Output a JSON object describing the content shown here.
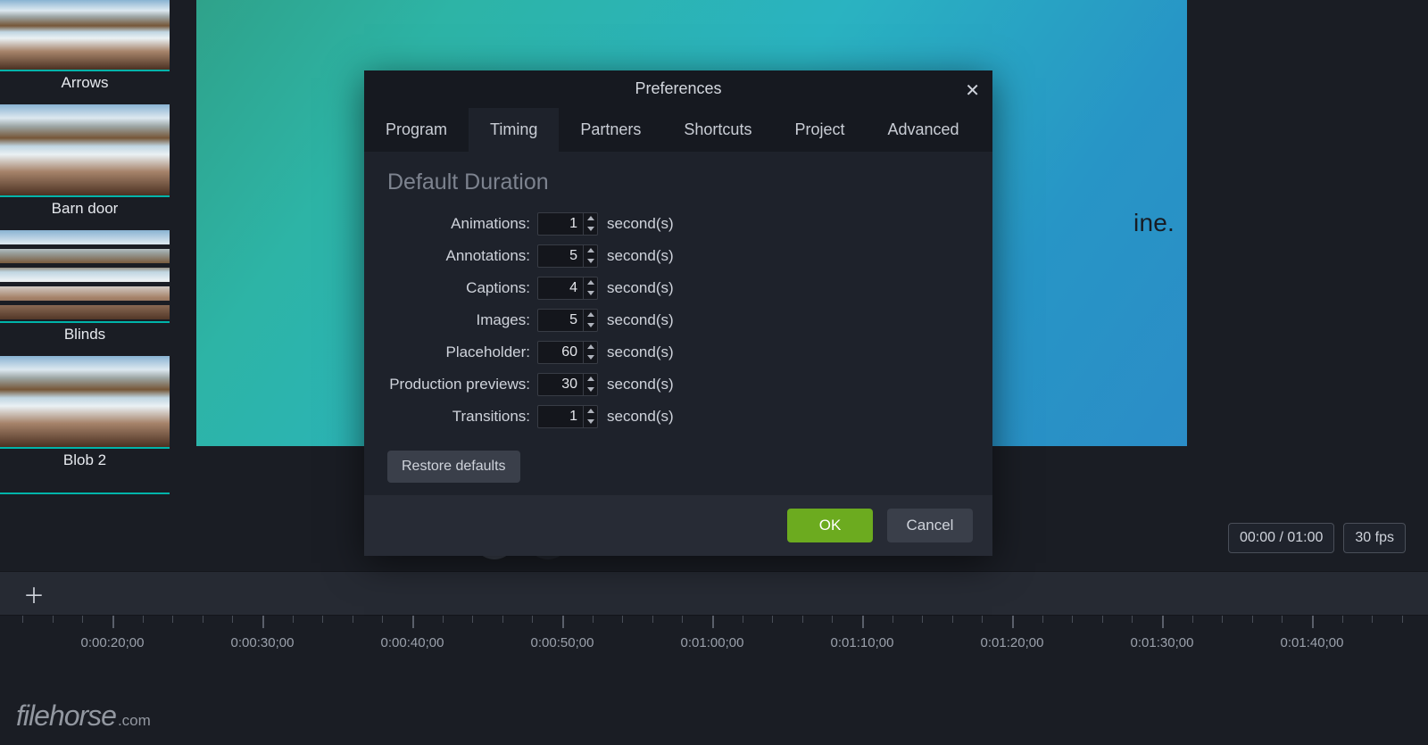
{
  "sidebar": {
    "items": [
      {
        "label": "Arrows"
      },
      {
        "label": "Barn door"
      },
      {
        "label": "Blinds"
      },
      {
        "label": "Blob 2"
      }
    ]
  },
  "canvas": {
    "heading_fragment": "ine."
  },
  "player": {
    "timecode": "00:00 / 01:00",
    "fps": "30 fps"
  },
  "timeline": {
    "ticks": [
      "0:00:20;00",
      "0:00:30;00",
      "0:00:40;00",
      "0:00:50;00",
      "0:01:00;00",
      "0:01:10;00",
      "0:01:20;00",
      "0:01:30;00",
      "0:01:40;00"
    ]
  },
  "dialog": {
    "title": "Preferences",
    "tabs": [
      "Program",
      "Timing",
      "Partners",
      "Shortcuts",
      "Project",
      "Advanced"
    ],
    "active_tab": "Timing",
    "section_title": "Default Duration",
    "unit": "second(s)",
    "rows": [
      {
        "label": "Animations:",
        "value": "1"
      },
      {
        "label": "Annotations:",
        "value": "5"
      },
      {
        "label": "Captions:",
        "value": "4"
      },
      {
        "label": "Images:",
        "value": "5"
      },
      {
        "label": "Placeholder:",
        "value": "60"
      },
      {
        "label": "Production previews:",
        "value": "30"
      },
      {
        "label": "Transitions:",
        "value": "1"
      }
    ],
    "restore_label": "Restore defaults",
    "ok_label": "OK",
    "cancel_label": "Cancel"
  },
  "watermark": {
    "name": "filehorse",
    "tld": ".com"
  }
}
